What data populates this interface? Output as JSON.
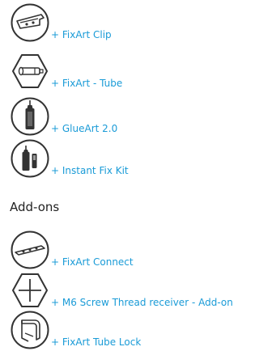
{
  "products": [
    {
      "label": "+ FixArt Clip",
      "icon": "fixart-clip-icon"
    },
    {
      "label": "+ FixArt - Tube",
      "icon": "fixart-tube-icon"
    },
    {
      "label": "+ GlueArt 2.0",
      "icon": "glueart-icon"
    },
    {
      "label": "+ Instant Fix Kit",
      "icon": "instant-fix-kit-icon"
    }
  ],
  "addons": {
    "heading": "Add-ons",
    "items": [
      {
        "label": "+ FixArt Connect",
        "icon": "fixart-connect-icon"
      },
      {
        "label": "+ M6 Screw Thread receiver - Add-on",
        "icon": "m6-screw-thread-icon"
      },
      {
        "label": "+ FixArt Tube Lock",
        "icon": "fixart-tube-lock-icon"
      }
    ]
  },
  "colors": {
    "link": "#1a9bd7",
    "icon_stroke": "#333333",
    "heading": "#222222"
  }
}
